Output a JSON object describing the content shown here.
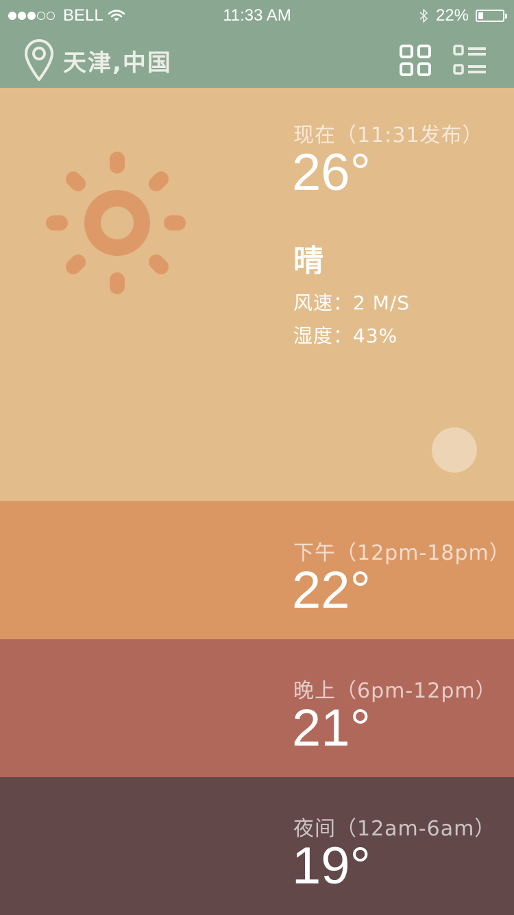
{
  "status_bar": {
    "carrier": "BELL",
    "time": "11:33 AM",
    "battery": "22%",
    "battery_level": 0.22,
    "signal_bars_filled": 3,
    "signal_bars_total": 5
  },
  "header": {
    "location": "天津,中国",
    "location_icon": "map-pin-icon",
    "grid_icon": "grid-view-icon",
    "list_icon": "list-view-icon"
  },
  "now": {
    "label": "现在（11:31发布）",
    "temperature": "26°",
    "condition": "晴",
    "wind": "风速：2 M/S",
    "humidity": "湿度：43%",
    "icon": "sun-icon"
  },
  "periods": [
    {
      "label": "下午（12pm-18pm）",
      "temperature": "22°"
    },
    {
      "label": "晚上（6pm-12pm）",
      "temperature": "21°"
    },
    {
      "label": "夜间（12am-6am）",
      "temperature": "19°"
    }
  ],
  "colors": {
    "header_bg": "#8aa791",
    "now_bg": "#e2bc8a",
    "afternoon_bg": "#da9764",
    "evening_bg": "#b0685b",
    "night_bg": "#624849",
    "sun_icon": "#dd9a68"
  }
}
